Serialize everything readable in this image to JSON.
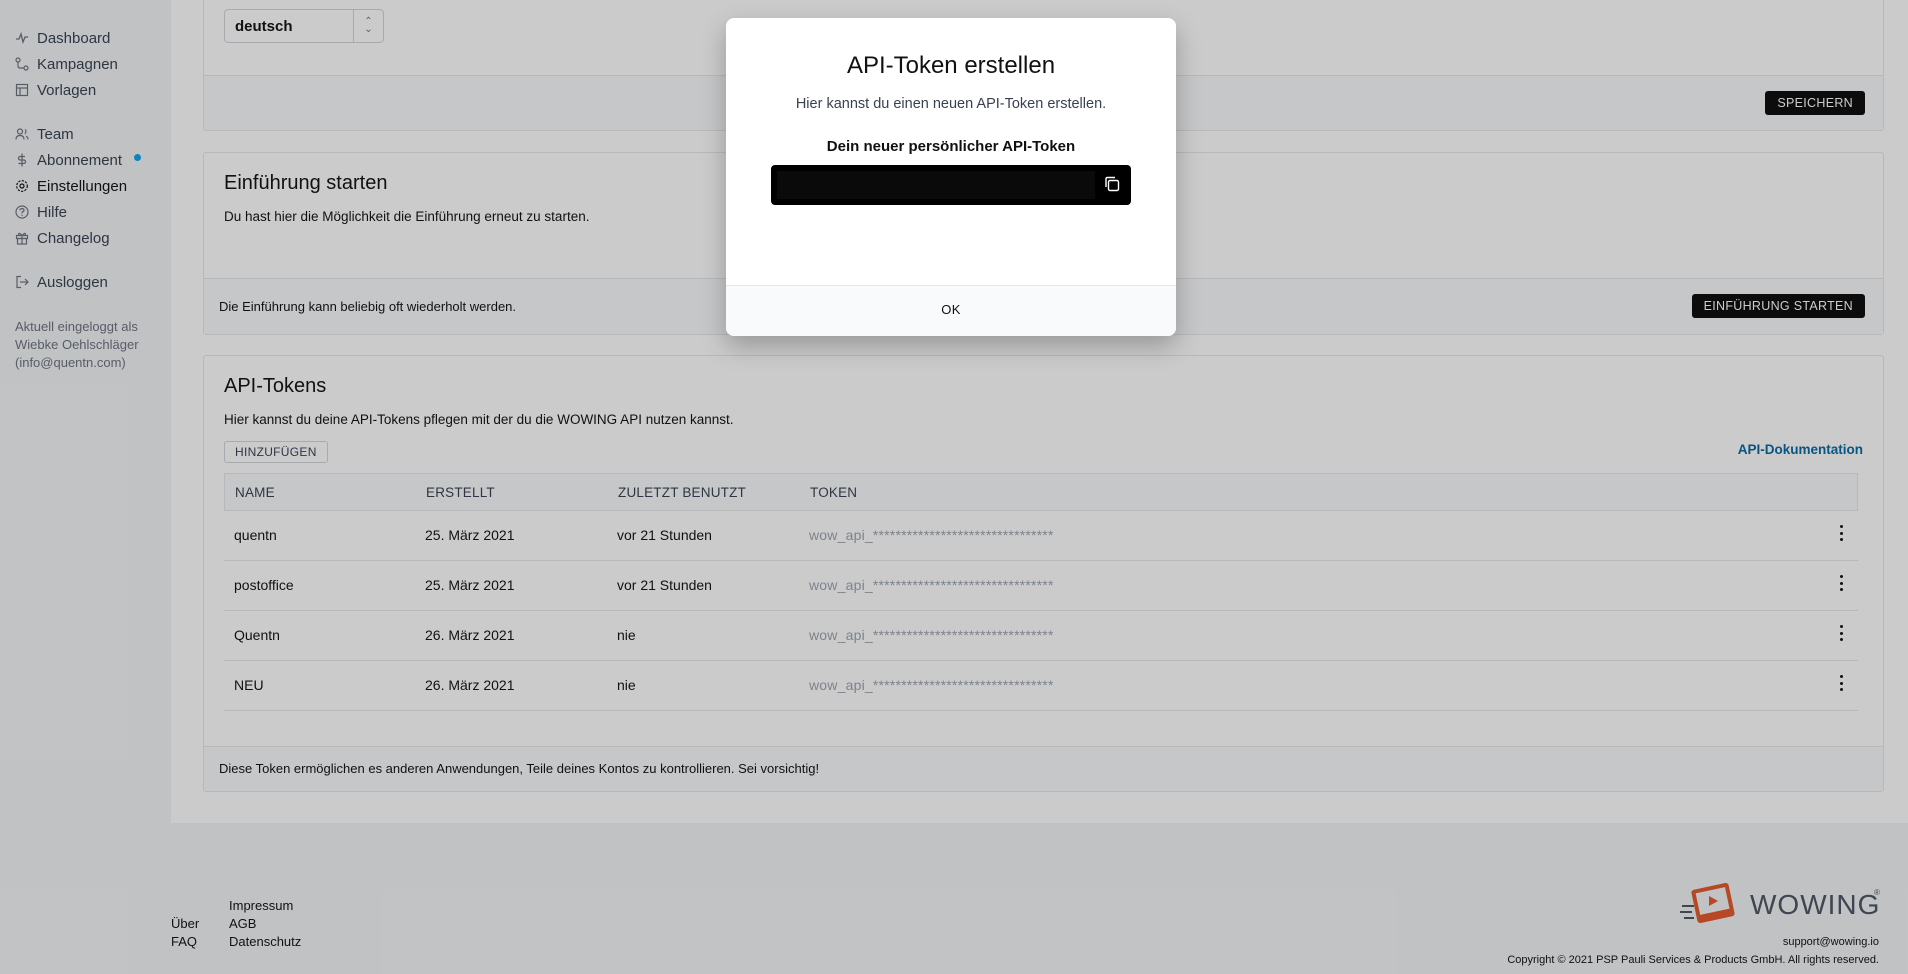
{
  "sidebar": {
    "items": [
      {
        "label": "Dashboard",
        "icon": "activity-icon"
      },
      {
        "label": "Kampagnen",
        "icon": "flow-icon"
      },
      {
        "label": "Vorlagen",
        "icon": "template-icon"
      },
      {
        "label": "Team",
        "icon": "users-icon"
      },
      {
        "label": "Abonnement",
        "icon": "dollar-icon"
      },
      {
        "label": "Einstellungen",
        "icon": "gear-icon"
      },
      {
        "label": "Hilfe",
        "icon": "help-icon"
      },
      {
        "label": "Changelog",
        "icon": "gift-icon"
      },
      {
        "label": "Ausloggen",
        "icon": "logout-icon"
      }
    ],
    "login_line1": "Aktuell eingeloggt als",
    "login_line2": "Wiebke Oehlschläger",
    "login_line3": "(info@quentn.com)"
  },
  "language_panel": {
    "select_value": "deutsch",
    "save_label": "SPEICHERN"
  },
  "intro_panel": {
    "title": "Einführung starten",
    "description": "Du hast hier die Möglichkeit die Einführung erneut zu starten.",
    "footer_text": "Die Einführung kann beliebig oft wiederholt werden.",
    "button_label": "EINFÜHRUNG STARTEN"
  },
  "api_panel": {
    "title": "API-Tokens",
    "description": "Hier kannst du deine API-Tokens pflegen mit der du die WOWING API nutzen kannst.",
    "add_label": "HINZUFÜGEN",
    "doc_link": "API-Dokumentation",
    "columns": [
      "NAME",
      "ERSTELLT",
      "ZULETZT BENUTZT",
      "TOKEN"
    ],
    "rows": [
      {
        "name": "quentn",
        "created": "25. März 2021",
        "last_used": "vor 21 Stunden",
        "token": "wow_api_********************************"
      },
      {
        "name": "postoffice",
        "created": "25. März 2021",
        "last_used": "vor 21 Stunden",
        "token": "wow_api_********************************"
      },
      {
        "name": "Quentn",
        "created": "26. März 2021",
        "last_used": "nie",
        "token": "wow_api_********************************"
      },
      {
        "name": "NEU",
        "created": "26. März 2021",
        "last_used": "nie",
        "token": "wow_api_********************************"
      }
    ],
    "footer_text": "Diese Token ermöglichen es anderen Anwendungen, Teile deines Kontos zu kontrollieren. Sei vorsichtig!"
  },
  "footer": {
    "links": [
      "Impressum",
      "Über",
      "AGB",
      "FAQ",
      "Datenschutz"
    ],
    "brand": "WOWING",
    "support": "support@wowing.io",
    "copyright": "Copyright © 2021 PSP Pauli Services & Products GmbH. All rights reserved."
  },
  "modal": {
    "title": "API-Token erstellen",
    "subtitle": "Hier kannst du einen neuen API-Token erstellen.",
    "label": "Dein neuer persönlicher API-Token",
    "token_value": "",
    "ok_label": "OK"
  },
  "colors": {
    "accent": "#0ea5e9",
    "link": "#0369a1",
    "button_dark": "#0b0b0b",
    "logo_orange": "#e5582b"
  }
}
